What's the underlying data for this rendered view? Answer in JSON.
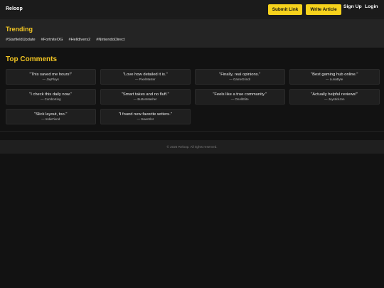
{
  "header": {
    "logo": "Reloop",
    "submit_label": "Submit Link",
    "write_label": "Write Article",
    "signup_label": "Sign Up",
    "login_label": "Login"
  },
  "trending": {
    "title": "Trending",
    "tags": [
      "#StarfieldUpdate",
      "#FortniteOG",
      "#Helldivers2",
      "#NintendoDirect"
    ]
  },
  "comments": {
    "title": "Top Comments",
    "items": [
      {
        "quote": "\"This saved me hours!\"",
        "author": "— JayPlays"
      },
      {
        "quote": "\"Love how detailed it is.\"",
        "author": "— PixelMaster"
      },
      {
        "quote": "\"Finally, real opinions.\"",
        "author": "— GameGrindr"
      },
      {
        "quote": "\"Best gaming hub online.\"",
        "author": "— LunaByte"
      },
      {
        "quote": "\"I check this daily now.\"",
        "author": "— ComboKing"
      },
      {
        "quote": "\"Smart takes and no fluff.\"",
        "author": "— ButtonMasher"
      },
      {
        "quote": "\"Feels like a true community.\"",
        "author": "— OnAllElite"
      },
      {
        "quote": "\"Actually helpful reviews!\"",
        "author": "— JoystickJon"
      },
      {
        "quote": "\"Slick layout, too.\"",
        "author": "— IndieFiend"
      },
      {
        "quote": "\"I found new favorite writers.\"",
        "author": "— SaveSlot"
      }
    ]
  },
  "footer": {
    "text": "© 2025 Reloop. All rights reserved."
  },
  "colors": {
    "accent": "#f3c623",
    "button": "#f6d21c",
    "background": "#121212"
  }
}
